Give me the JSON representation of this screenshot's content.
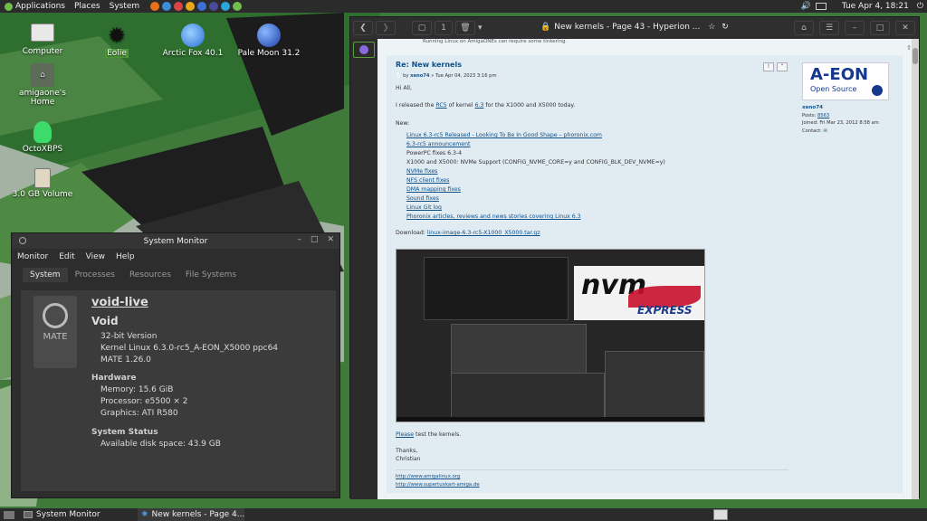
{
  "panel": {
    "applications": "Applications",
    "places": "Places",
    "system": "System",
    "clock": "Tue Apr  4, 18:21",
    "quicklaunch_colors": [
      "#e8701a",
      "#3a8fd8",
      "#d44",
      "#e8a817",
      "#3c6fd8",
      "#4a4a9a",
      "#2aa6d8",
      "#6fbf4a"
    ]
  },
  "desktop": {
    "icons": [
      {
        "label": "Computer"
      },
      {
        "label": "amigaone's Home"
      },
      {
        "label": "OctoXBPS"
      },
      {
        "label": "3.0 GB Volume"
      },
      {
        "label": "Eolie"
      },
      {
        "label": "Arctic Fox 40.1"
      },
      {
        "label": "Pale Moon 31.2"
      }
    ]
  },
  "sysmon": {
    "title": "System Monitor",
    "menu": [
      "Monitor",
      "Edit",
      "View",
      "Help"
    ],
    "tabs": [
      "System",
      "Processes",
      "Resources",
      "File Systems"
    ],
    "logo_text": "MATE",
    "hostname": "void-live",
    "distro": "Void",
    "version": "32-bit Version",
    "kernel": "Kernel Linux 6.3.0-rc5_A-EON_X5000 ppc64",
    "mate": "MATE 1.26.0",
    "hardware_heading": "Hardware",
    "memory": "Memory:   15.6 GiB",
    "processor": "Processor: e5500 × 2",
    "graphics": "Graphics:  ATI R580",
    "status_heading": "System Status",
    "disk": "Available disk space: 43.9 GB"
  },
  "browser": {
    "title": "New kernels - Page 43 - Hyperion ...",
    "tab_count": "1",
    "post": {
      "banner": "Running Linux on AmigaONEs can require some tinkering.",
      "title": "Re: New kernels",
      "by": "by",
      "author": "xeno74",
      "date": "» Tue Apr 04, 2023 3:16 pm",
      "greeting": "Hi All,",
      "intro_pre": "I released the ",
      "rc5": "RC5",
      "intro_mid": " of kernel ",
      "ver": "6.3",
      "intro_post": " for the X1000 and X5000 today.",
      "new": "New:",
      "items": [
        "Linux 6.3-rc5 Released - Looking To Be In Good Shape – phoronix.com",
        "6.3-rc5 announcement",
        "PowerPC fixes 6.3-4",
        "X1000 and X5000: NVMe Support (CONFIG_NVME_CORE=y and CONFIG_BLK_DEV_NVME=y)",
        "NVMe fixes",
        "NFS client fixes",
        "DMA mapping fixes",
        "Sound fixes",
        "Linux Git log",
        "Phoronix articles, reviews and news stories covering Linux 6.3"
      ],
      "download_label": "Download: ",
      "download_link": "linux-image-6.3-rc5-X1000_X5000.tar.gz",
      "please": "Please",
      "test": " test the kernels.",
      "thanks": "Thanks,",
      "sig": "Christian",
      "link1": "http://www.amigalinux.org",
      "link2": "http://www.supertuxkart-amiga.de",
      "side_logo": "A-EON",
      "side_logo_sub": "Open Source",
      "side_user": "xeno74",
      "posts_label": "Posts: ",
      "posts_count": "8563",
      "joined": "Joined: Fri Mar 23, 2012 8:58 am",
      "contact": "Contact:",
      "nvm": "nvm",
      "express": "EXPRESS"
    }
  },
  "taskbar": {
    "items": [
      "System Monitor",
      "New kernels - Page 4..."
    ]
  }
}
